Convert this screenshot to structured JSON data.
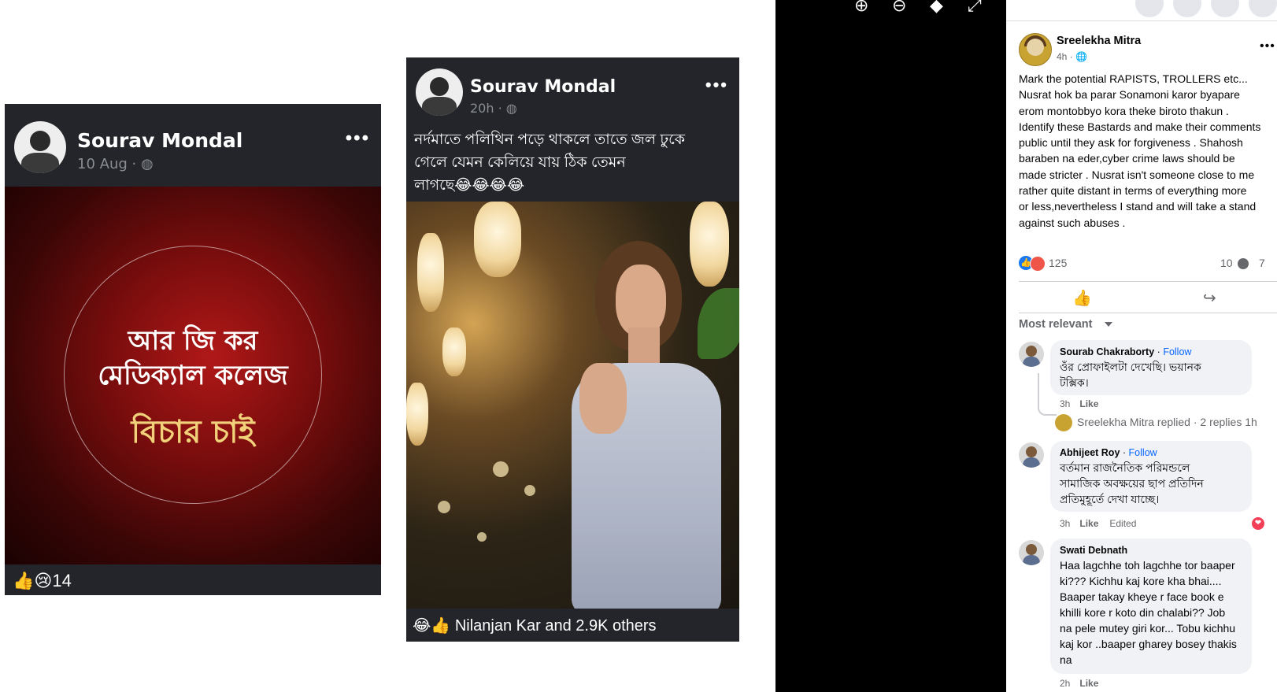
{
  "viewer": {
    "left_post": {
      "author": "Sourav Mondal",
      "time": "10 Aug",
      "dots": "•••",
      "image_text": [
        "আর জি কর",
        "মেডিক্যাল কলেজ",
        "বিচার চাই"
      ],
      "reaction_icons": "👍😢",
      "reaction_count": "14"
    },
    "right_post": {
      "author": "Sourav Mondal",
      "time": "20h",
      "dots": "•••",
      "caption_lines": [
        "নর্দমাতে পলিথিন পড়ে থাকলে তাতে জল ঢুকে",
        "গেলে যেমন কেলিয়ে যায় ঠিক তেমন",
        "লাগছে😂😂😂😂"
      ],
      "reactions_text": "Nilanjan Kar and 2.9K others",
      "reaction_icons": "😂👍"
    },
    "toolbar_icons": [
      "zoom-in-icon",
      "zoom-out-icon",
      "tag-icon",
      "fullscreen-icon"
    ]
  },
  "post": {
    "author": "Sreelekha Mitra",
    "time": "4h · 🌐",
    "more": "•••",
    "text_lines": [
      "Mark the potential RAPISTS, TROLLERS etc...",
      "Nusrat hok ba parar Sonamoni karor byapare",
      "erom montobbyo kora theke biroto thakun .",
      "Identify these Bastards and make their comments",
      "public until they ask for forgiveness . Shahosh",
      "baraben na eder,cyber crime laws should be",
      "made stricter . Nusrat isn't someone close to me",
      "rather quite distant in terms of everything more",
      "or less,nevertheless I stand and will take a stand",
      "against such abuses ."
    ],
    "reaction_count": "125",
    "comment_count": "10",
    "share_count": "7",
    "like_icon": "👍",
    "share_icon": "↪",
    "sort_label": "Most relevant"
  },
  "comments": [
    {
      "author": "Sourab Chakraborty",
      "follow": "Follow",
      "text_lines": [
        "ওঁর প্রোফাইলটা দেখেছি। ভয়ানক",
        "টক্সিক।"
      ],
      "time": "3h",
      "like": "Like"
    },
    {
      "author": "Abhijeet Roy",
      "follow": "Follow",
      "text_lines": [
        "বর্তমান রাজনৈতিক পরিমন্ডলে",
        "সামাজিক অবক্ষয়ের ছাপ প্রতিদিন",
        "প্রতিমুহূর্তে দেখা যাচ্ছে।"
      ],
      "time": "3h",
      "like": "Like",
      "edited": "Edited",
      "reaction_icon": "❤"
    },
    {
      "author": "Swati Debnath",
      "text_lines": [
        "Haa lagchhe toh lagchhe tor baaper",
        "ki??? Kichhu kaj kore kha bhai....",
        "Baaper takay kheye r face book e",
        "khilli kore r koto din chalabi?? Job",
        "na pele mutey giri kor... Tobu kichhu",
        "kaj kor ..baaper gharey bosey thakis",
        "na"
      ],
      "time": "2h",
      "like": "Like"
    }
  ],
  "reply_summary": {
    "text": "Sreelekha Mitra replied · 2 replies",
    "time": "1h"
  }
}
